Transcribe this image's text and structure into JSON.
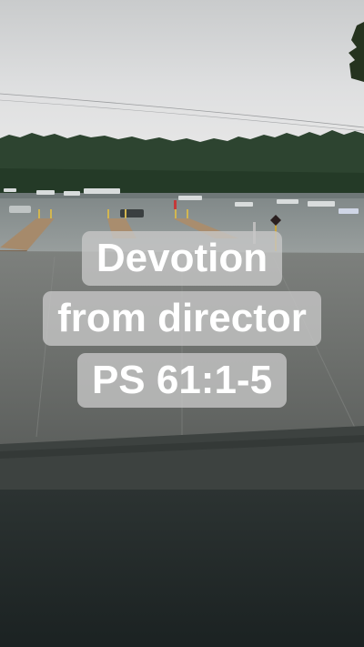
{
  "story": {
    "caption_lines": [
      "Devotion",
      "from director",
      "PS 61:1-5"
    ],
    "caption_background": "#c8c8c8",
    "caption_text_color": "#ffffff"
  },
  "photo": {
    "scene_elements": [
      "overcast-sky",
      "tree-line",
      "lake",
      "boats",
      "wooden-docks",
      "boat-ramp",
      "warning-sign"
    ]
  },
  "colors": {
    "sky": "#d9dadb",
    "trees": "#2f4630",
    "water": "#8d9493",
    "dock": "#a98c6c",
    "ramp": "#6b6e6b",
    "bottom_fill": "#1e2626"
  }
}
